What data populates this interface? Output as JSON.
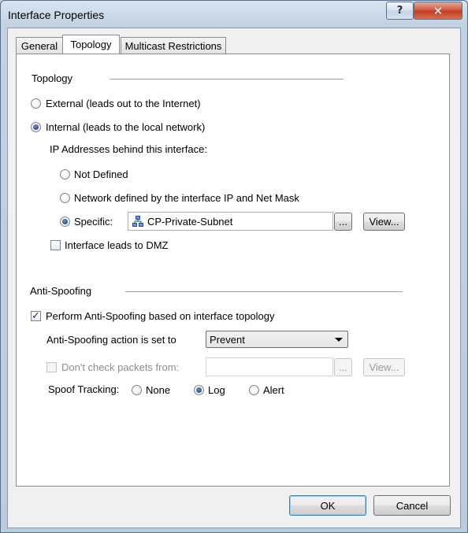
{
  "window": {
    "title": "Interface Properties"
  },
  "tabs": [
    {
      "label": "General"
    },
    {
      "label": "Topology"
    },
    {
      "label": "Multicast Restrictions"
    }
  ],
  "topology": {
    "section_label": "Topology",
    "external_label": "External (leads out to the Internet)",
    "internal_label": "Internal (leads to the local network)",
    "selected": "internal",
    "ip_behind_label": "IP Addresses behind this interface:",
    "not_defined_label": "Not Defined",
    "network_defined_label": "Network defined by the interface IP and Net Mask",
    "specific_label": "Specific:",
    "ip_selected": "specific",
    "specific_value": "CP-Private-Subnet",
    "specific_icon": "network-object-icon",
    "browse_label": "...",
    "view_label": "View...",
    "dmz_label": "Interface leads to DMZ",
    "dmz_checked": false
  },
  "anti_spoofing": {
    "section_label": "Anti-Spoofing",
    "perform_label": "Perform Anti-Spoofing based on interface topology",
    "perform_checked": true,
    "action_label": "Anti-Spoofing action is set to",
    "action_value": "Prevent",
    "dont_check_label": "Don't check packets from:",
    "dont_check_checked": false,
    "dont_check_value": "",
    "browse_label": "...",
    "view_label": "View...",
    "spoof_tracking_label": "Spoof Tracking:",
    "tracking_options": [
      {
        "label": "None"
      },
      {
        "label": "Log"
      },
      {
        "label": "Alert"
      }
    ],
    "tracking_selected": "Log"
  },
  "footer": {
    "ok_label": "OK",
    "cancel_label": "Cancel"
  }
}
